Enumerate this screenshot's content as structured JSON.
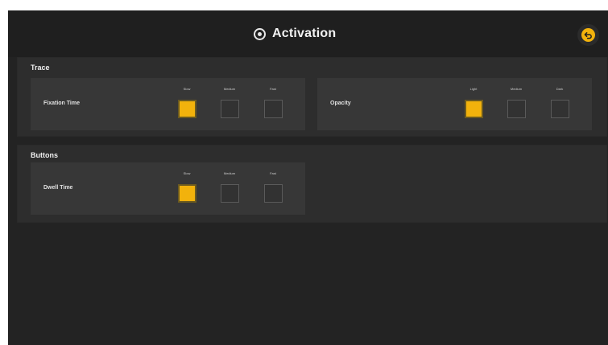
{
  "header": {
    "title": "Activation",
    "title_icon": "target-icon",
    "back_icon": "undo-icon"
  },
  "colors": {
    "accent": "#f2b20c",
    "background": "#232323",
    "panel": "#2d2d2d",
    "card": "#373737"
  },
  "sections": {
    "trace": {
      "title": "Trace",
      "fixation": {
        "label": "Fixation Time",
        "options": [
          "Slow",
          "Medium",
          "Fast"
        ],
        "selected": "Slow"
      },
      "opacity": {
        "label": "Opacity",
        "options": [
          "Light",
          "Medium",
          "Dark"
        ],
        "selected": "Light"
      }
    },
    "buttons": {
      "title": "Buttons",
      "dwell": {
        "label": "Dwell Time",
        "options": [
          "Slow",
          "Medium",
          "Fast"
        ],
        "selected": "Slow"
      }
    }
  }
}
